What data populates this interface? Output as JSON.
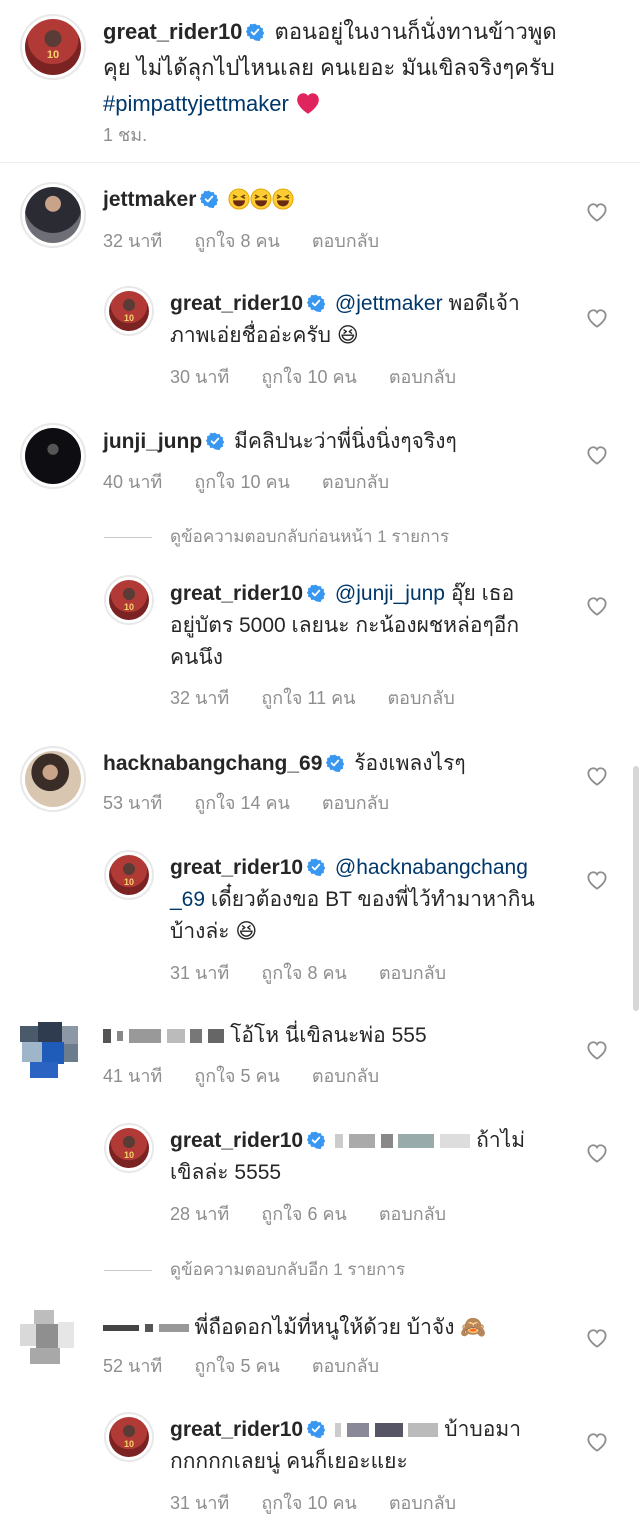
{
  "caption": {
    "username": "great_rider10",
    "text_line1": "ตอนอยู่ในงานก็นั่งทานข้าวพูด",
    "text_line2": "คุย ไม่ได้ลุกไปไหนเลย คนเยอะ มันเขิลจริงๆครับ",
    "hashtag": "#pimpattyjettmaker",
    "emoji": "❤",
    "time": "1 ชม."
  },
  "comments": [
    {
      "id": "c1",
      "username": "jettmaker",
      "verified": true,
      "text": "😆😆😆",
      "time": "32 นาที",
      "likes": "ถูกใจ 8 คน",
      "reply": "ตอบกลับ",
      "replies": [
        {
          "username": "great_rider10",
          "mention": "@jettmaker",
          "text_line1": "พอดีเจ้า",
          "text_line2": "ภาพเอ่ยชื่ออ่ะครับ 😆",
          "time": "30 นาที",
          "likes": "ถูกใจ 10 คน",
          "reply": "ตอบกลับ"
        }
      ]
    },
    {
      "id": "c2",
      "username": "junji_junp",
      "verified": true,
      "text": "มีคลิปนะว่าพี่นิ่งนิ่งๆจริงๆ",
      "time": "40 นาที",
      "likes": "ถูกใจ 10 คน",
      "reply": "ตอบกลับ",
      "view_previous": "ดูข้อความตอบกลับก่อนหน้า 1 รายการ",
      "replies": [
        {
          "username": "great_rider10",
          "mention": "@junji_junp",
          "text_line1": "อุ๊ย เธอ",
          "text_line2": "อยู่บัตร 5000 เลยนะ กะน้องผชหล่อๆอีก",
          "text_line3": "คนนึง",
          "time": "32 นาที",
          "likes": "ถูกใจ 11 คน",
          "reply": "ตอบกลับ"
        }
      ]
    },
    {
      "id": "c3",
      "username": "hacknabangchang_69",
      "verified": true,
      "text": "ร้องเพลงไรๆ",
      "time": "53 นาที",
      "likes": "ถูกใจ 14 คน",
      "reply": "ตอบกลับ",
      "replies": [
        {
          "username": "great_rider10",
          "mention_line1": "@hacknabangchang",
          "mention_line2": "_69",
          "text_line2": "เดี๋ยวต้องขอ BT ของพี่ไว้ทำมาหากิน",
          "text_line3": "บ้างล่ะ 😆",
          "time": "31 นาที",
          "likes": "ถูกใจ 8 คน",
          "reply": "ตอบกลับ"
        }
      ]
    },
    {
      "id": "c4",
      "username": "",
      "verified": false,
      "text": "โอ้โห นี่เขิลนะพ่อ 555",
      "time": "41 นาที",
      "likes": "ถูกใจ 5 คน",
      "reply": "ตอบกลับ",
      "replies": [
        {
          "username": "great_rider10",
          "text_line1": "ถ้าไม่",
          "text_line2": "เขิลล่ะ 5555",
          "time": "28 นาที",
          "likes": "ถูกใจ 6 คน",
          "reply": "ตอบกลับ"
        }
      ],
      "view_more": "ดูข้อความตอบกลับอีก 1 รายการ"
    },
    {
      "id": "c5",
      "username": "",
      "verified": false,
      "text": "พี่ถือดอกไม้ที่หนูให้ด้วย บ้าจัง 🙈",
      "time": "52 นาที",
      "likes": "ถูกใจ 5 คน",
      "reply": "ตอบกลับ",
      "replies": [
        {
          "username": "great_rider10",
          "text_line1": "บ้าบอมา",
          "text_line2": "กกกกกเลยนู่ คนก็เยอะแยะ",
          "time": "31 นาที",
          "likes": "ถูกใจ 10 คน",
          "reply": "ตอบกลับ"
        }
      ]
    }
  ],
  "avatar_number": "10",
  "colors": {
    "verified": "#3897f0",
    "link": "#00376b",
    "meta": "#8e8e8e"
  }
}
